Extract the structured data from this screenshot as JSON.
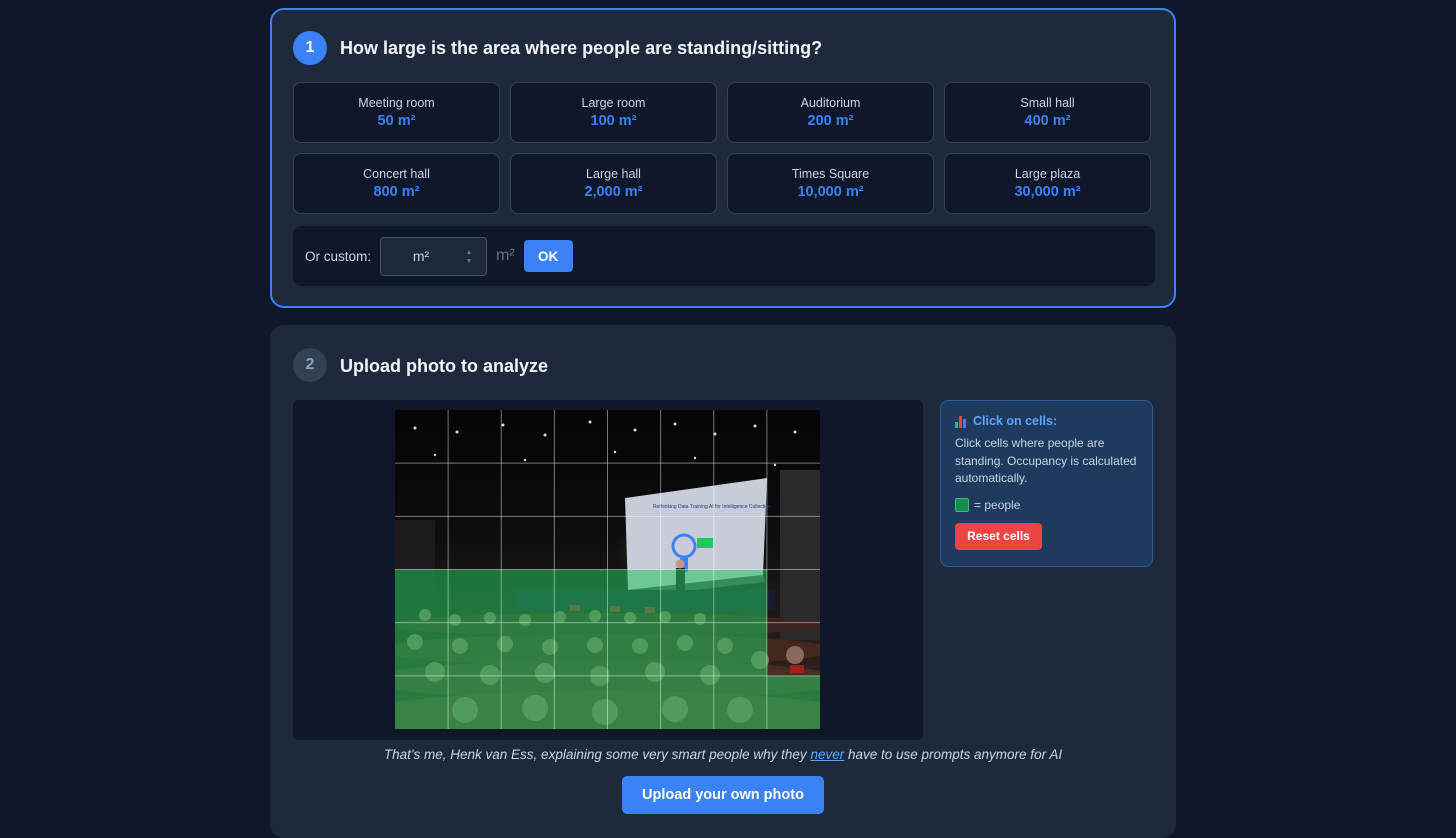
{
  "step1": {
    "number": "1",
    "title": "How large is the area where people are standing/sitting?",
    "presets": [
      {
        "name": "Meeting room",
        "value": "50 m²"
      },
      {
        "name": "Large room",
        "value": "100 m²"
      },
      {
        "name": "Auditorium",
        "value": "200 m²"
      },
      {
        "name": "Small hall",
        "value": "400 m²"
      },
      {
        "name": "Concert hall",
        "value": "800 m²"
      },
      {
        "name": "Large hall",
        "value": "2,000 m²"
      },
      {
        "name": "Times Square",
        "value": "10,000 m²"
      },
      {
        "name": "Large plaza",
        "value": "30,000 m²"
      }
    ],
    "custom": {
      "label": "Or custom:",
      "placeholder": "m²",
      "value": "",
      "unit": "m²",
      "ok_label": "OK"
    }
  },
  "step2": {
    "number": "2",
    "title": "Upload photo to analyze",
    "photo": {
      "grid_columns": 8,
      "grid_rows": 6,
      "selected_cells": [
        [
          3,
          0
        ],
        [
          3,
          1
        ],
        [
          3,
          2
        ],
        [
          3,
          3
        ],
        [
          3,
          4
        ],
        [
          3,
          5
        ],
        [
          3,
          6
        ],
        [
          4,
          0
        ],
        [
          4,
          1
        ],
        [
          4,
          2
        ],
        [
          4,
          3
        ],
        [
          4,
          4
        ],
        [
          4,
          5
        ],
        [
          4,
          6
        ],
        [
          5,
          0
        ],
        [
          5,
          1
        ],
        [
          5,
          2
        ],
        [
          5,
          3
        ],
        [
          5,
          4
        ],
        [
          5,
          5
        ],
        [
          5,
          6
        ],
        [
          5,
          7
        ]
      ],
      "slide_title": "Rethinking Data Training AI for Intelligence Collection"
    },
    "info": {
      "icon": "bar-chart-icon",
      "title": "Click on cells:",
      "text": "Click cells where people are standing. Occupancy is calculated automatically.",
      "legend": "= people",
      "reset_label": "Reset cells"
    },
    "caption": {
      "before": "That's me, Henk van Ess, explaining some very smart people why they ",
      "link": "never",
      "after": " have to use prompts anymore for AI"
    },
    "upload_label": "Upload your own photo"
  },
  "colors": {
    "accent": "#3b82f6",
    "danger": "#ef4444",
    "people": "#22c55e",
    "background": "#0f172a",
    "card": "#1e293b"
  }
}
